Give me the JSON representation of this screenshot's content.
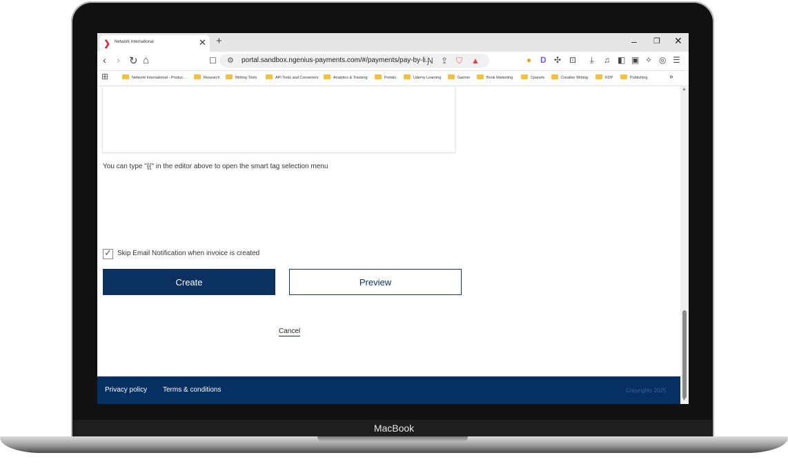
{
  "browser": {
    "tab_title": "Network International",
    "tab_close": "✕",
    "new_tab": "+",
    "window_controls": {
      "minimize": "–",
      "maximize": "❐",
      "close": "✕"
    },
    "nav": {
      "back": "‹",
      "forward": "›",
      "reload": "↻",
      "home": "⌂",
      "bookmark": "☐"
    },
    "url": "portal.sandbox.ngenius-payments.com/#/payments/pay-by-li...",
    "bookmarks": [
      "Network International - Produc...",
      "Research",
      "Writing Tools",
      "API Tools and Converters",
      "Analytics & Tracking",
      "Portals",
      "Udemy Learning",
      "Garmin",
      "Book Marketing",
      "Cpanels",
      "Creative Writing",
      "KDP",
      "Publishing"
    ],
    "bookmarks_more": "»",
    "brand_colors": {
      "brave": "#fb542b",
      "accent": "#e3262f"
    }
  },
  "page": {
    "hint": "You can type \"{{\" in the editor above to open the smart tag selection menu",
    "skip_email_label": "Skip Email Notification when invoice is created",
    "skip_email_checked": true,
    "create_label": "Create",
    "preview_label": "Preview",
    "cancel_label": "Cancel"
  },
  "footer": {
    "privacy": "Privacy policy",
    "terms": "Terms & conditions",
    "copyright": "Copyrights 2025"
  },
  "device": {
    "label": "MacBook"
  },
  "colors": {
    "primary": "#0b3160",
    "footer": "#062f62"
  }
}
